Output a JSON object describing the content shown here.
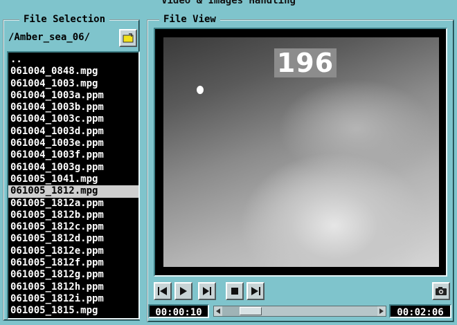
{
  "window": {
    "title": "Video & Images Handling"
  },
  "file_selection": {
    "label": "File Selection",
    "path": "/Amber_sea_06/",
    "files": [
      "..",
      "061004_0848.mpg",
      "061004_1003.mpg",
      "061004_1003a.ppm",
      "061004_1003b.ppm",
      "061004_1003c.ppm",
      "061004_1003d.ppm",
      "061004_1003e.ppm",
      "061004_1003f.ppm",
      "061004_1003g.ppm",
      "061005_1041.mpg",
      "061005_1812.mpg",
      "061005_1812a.ppm",
      "061005_1812b.ppm",
      "061005_1812c.ppm",
      "061005_1812d.ppm",
      "061005_1812e.ppm",
      "061005_1812f.ppm",
      "061005_1812g.ppm",
      "061005_1812h.ppm",
      "061005_1812i.ppm",
      "061005_1815.mpg"
    ],
    "selected_index": 11
  },
  "file_view": {
    "label": "File View",
    "frame_counter": "196",
    "time_current": "00:00:10",
    "time_total": "00:02:06",
    "progress_fraction": 0.079
  },
  "icons": {
    "open_folder": "folder-icon",
    "skip_start": "skip-to-start-icon",
    "play": "play-icon",
    "step_forward": "step-forward-icon",
    "stop": "stop-icon",
    "skip_end": "skip-to-end-icon",
    "snapshot": "camera-icon"
  },
  "colors": {
    "background": "#7fc4cc",
    "list_bg": "#000000",
    "selected_row": "#cfcfcf"
  }
}
